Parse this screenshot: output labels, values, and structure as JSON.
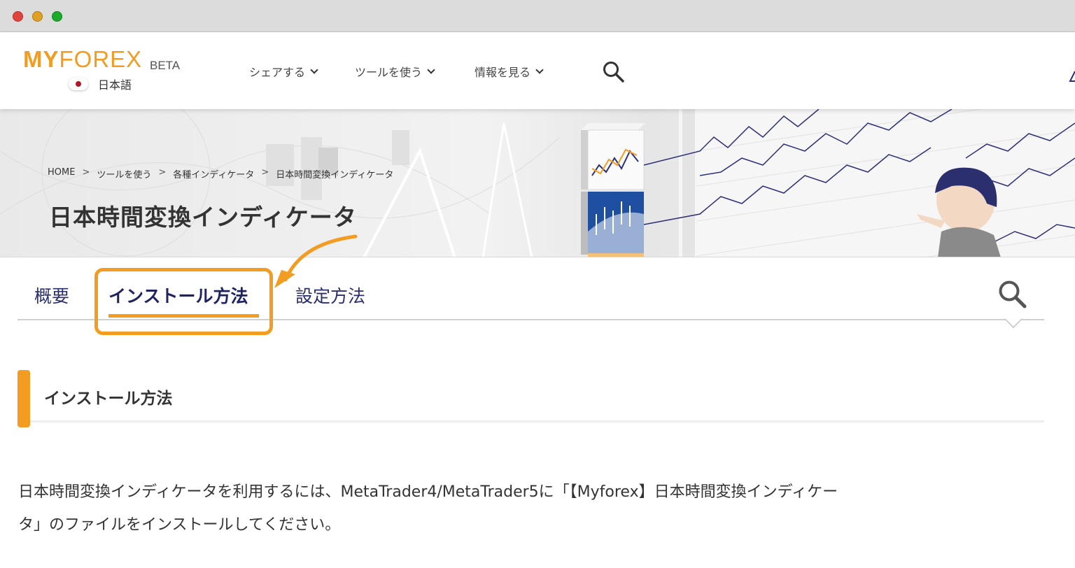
{
  "window": {
    "controls": [
      "close",
      "minimize",
      "maximize"
    ]
  },
  "header": {
    "logo": {
      "part1": "MY",
      "part2": "FOREX",
      "badge": "BETA"
    },
    "language": {
      "label": "日本語",
      "flag": "japan-flag-icon"
    },
    "nav": [
      {
        "label": "シェアする"
      },
      {
        "label": "ツールを使う"
      },
      {
        "label": "情報を見る"
      }
    ],
    "search_icon": "search-icon"
  },
  "hero": {
    "breadcrumb": [
      "HOME",
      "ツールを使う",
      "各種インディケータ",
      "日本時間変換インディケータ"
    ],
    "breadcrumb_separator": ">",
    "title": "日本時間変換インディケータ"
  },
  "tabs": {
    "items": [
      {
        "label": "概要",
        "active": false
      },
      {
        "label": "インストール方法",
        "active": true
      },
      {
        "label": "設定方法",
        "active": false
      }
    ],
    "search_icon": "search-icon"
  },
  "section": {
    "title": "インストール方法",
    "body_line1": "日本時間変換インディケータを利用するには、MetaTrader4/MetaTrader5に「【Myforex】日本時間変換インディケー",
    "body_line2": "タ」のファイルをインストールしてください。"
  },
  "colors": {
    "accent": "#f39c22",
    "nav_text": "#2a2e6e",
    "chart_line": "#2c2f7a"
  }
}
